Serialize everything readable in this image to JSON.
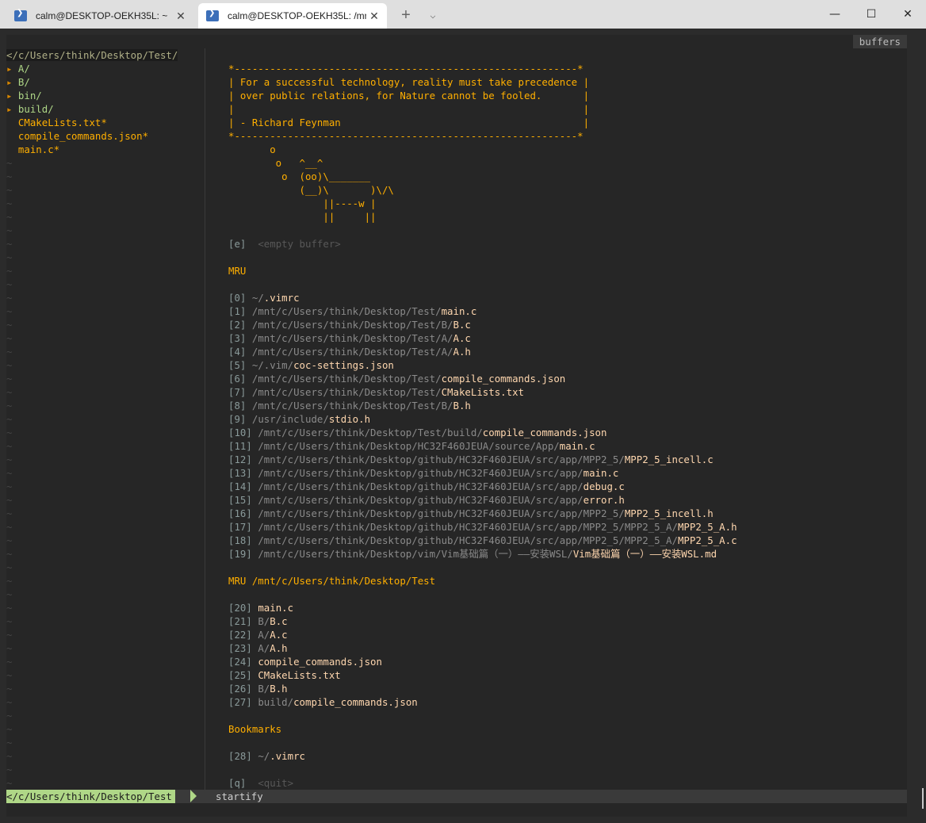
{
  "window": {
    "tabs": [
      {
        "title": "calm@DESKTOP-OEKH35L: ~",
        "active": false
      },
      {
        "title": "calm@DESKTOP-OEKH35L: /mn",
        "active": true
      }
    ],
    "new_tab": "+",
    "dropdown": "⌵",
    "minimize": "—",
    "maximize": "☐",
    "close": "✕",
    "tab_close": "✕"
  },
  "vim": {
    "buffers_label": "buffers",
    "tree": {
      "root": "</c/Users/think/Desktop/Test/",
      "items": [
        {
          "arrow": "▸ ",
          "name": "A/",
          "kind": "dir"
        },
        {
          "arrow": "▸ ",
          "name": "B/",
          "kind": "dir"
        },
        {
          "arrow": "▸ ",
          "name": "bin/",
          "kind": "dir"
        },
        {
          "arrow": "▸ ",
          "name": "build/",
          "kind": "dir"
        },
        {
          "arrow": "  ",
          "name": "CMakeLists.txt*",
          "kind": "file"
        },
        {
          "arrow": "  ",
          "name": "compile_commands.json*",
          "kind": "file"
        },
        {
          "arrow": "  ",
          "name": "main.c*",
          "kind": "file"
        }
      ],
      "tilde": "~"
    },
    "quote": [
      "*----------------------------------------------------------*",
      "| For a successful technology, reality must take precedence |",
      "| over public relations, for Nature cannot be fooled.       |",
      "|                                                           |",
      "| - Richard Feynman                                         |",
      "*----------------------------------------------------------*"
    ],
    "cow": [
      "       o",
      "        o   ^__^",
      "         o  (oo)\\_______",
      "            (__)\\       )\\/\\",
      "                ||----w |",
      "                ||     ||"
    ],
    "empty_buffer": {
      "key": "[e]",
      "label": "<empty buffer>"
    },
    "mru_header": "MRU",
    "mru": [
      {
        "idx": "[0]",
        "dir": "~/",
        "file": ".vimrc"
      },
      {
        "idx": "[1]",
        "dir": "/mnt/c/Users/think/Desktop/Test/",
        "file": "main.c"
      },
      {
        "idx": "[2]",
        "dir": "/mnt/c/Users/think/Desktop/Test/B/",
        "file": "B.c"
      },
      {
        "idx": "[3]",
        "dir": "/mnt/c/Users/think/Desktop/Test/A/",
        "file": "A.c"
      },
      {
        "idx": "[4]",
        "dir": "/mnt/c/Users/think/Desktop/Test/A/",
        "file": "A.h"
      },
      {
        "idx": "[5]",
        "dir": "~/.vim/",
        "file": "coc-settings.json"
      },
      {
        "idx": "[6]",
        "dir": "/mnt/c/Users/think/Desktop/Test/",
        "file": "compile_commands.json"
      },
      {
        "idx": "[7]",
        "dir": "/mnt/c/Users/think/Desktop/Test/",
        "file": "CMakeLists.txt"
      },
      {
        "idx": "[8]",
        "dir": "/mnt/c/Users/think/Desktop/Test/B/",
        "file": "B.h"
      },
      {
        "idx": "[9]",
        "dir": "/usr/include/",
        "file": "stdio.h"
      },
      {
        "idx": "[10]",
        "dir": "/mnt/c/Users/think/Desktop/Test/build/",
        "file": "compile_commands.json"
      },
      {
        "idx": "[11]",
        "dir": "/mnt/c/Users/think/Desktop/HC32F460JEUA/source/App/",
        "file": "main.c"
      },
      {
        "idx": "[12]",
        "dir": "/mnt/c/Users/think/Desktop/github/HC32F460JEUA/src/app/MPP2_5/",
        "file": "MPP2_5_incell.c"
      },
      {
        "idx": "[13]",
        "dir": "/mnt/c/Users/think/Desktop/github/HC32F460JEUA/src/app/",
        "file": "main.c"
      },
      {
        "idx": "[14]",
        "dir": "/mnt/c/Users/think/Desktop/github/HC32F460JEUA/src/app/",
        "file": "debug.c"
      },
      {
        "idx": "[15]",
        "dir": "/mnt/c/Users/think/Desktop/github/HC32F460JEUA/src/app/",
        "file": "error.h"
      },
      {
        "idx": "[16]",
        "dir": "/mnt/c/Users/think/Desktop/github/HC32F460JEUA/src/app/MPP2_5/",
        "file": "MPP2_5_incell.h"
      },
      {
        "idx": "[17]",
        "dir": "/mnt/c/Users/think/Desktop/github/HC32F460JEUA/src/app/MPP2_5/MPP2_5_A/",
        "file": "MPP2_5_A.h"
      },
      {
        "idx": "[18]",
        "dir": "/mnt/c/Users/think/Desktop/github/HC32F460JEUA/src/app/MPP2_5/MPP2_5_A/",
        "file": "MPP2_5_A.c"
      },
      {
        "idx": "[19]",
        "dir": "/mnt/c/Users/think/Desktop/vim/Vim基础篇（一）——安装WSL/",
        "file": "Vim基础篇（一）——安装WSL.md"
      }
    ],
    "mru_dir_header": "MRU /mnt/c/Users/think/Desktop/Test",
    "mru_dir": [
      {
        "idx": "[20]",
        "dir": "",
        "file": "main.c"
      },
      {
        "idx": "[21]",
        "dir": "B/",
        "file": "B.c"
      },
      {
        "idx": "[22]",
        "dir": "A/",
        "file": "A.c"
      },
      {
        "idx": "[23]",
        "dir": "A/",
        "file": "A.h"
      },
      {
        "idx": "[24]",
        "dir": "",
        "file": "compile_commands.json"
      },
      {
        "idx": "[25]",
        "dir": "",
        "file": "CMakeLists.txt"
      },
      {
        "idx": "[26]",
        "dir": "B/",
        "file": "B.h"
      },
      {
        "idx": "[27]",
        "dir": "build/",
        "file": "compile_commands.json"
      }
    ],
    "bookmarks_header": "Bookmarks",
    "bookmarks": [
      {
        "idx": "[28]",
        "dir": "~/",
        "file": ".vimrc"
      }
    ],
    "quit": {
      "key": "[q]",
      "label": "<quit>"
    },
    "status": {
      "left": "</c/Users/think/Desktop/Test",
      "filetype": "startify"
    }
  }
}
